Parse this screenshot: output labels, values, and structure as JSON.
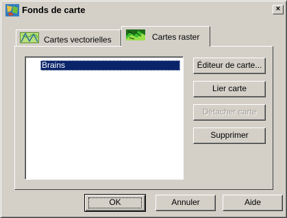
{
  "window": {
    "title": "Fonds de carte",
    "close_label": "×"
  },
  "tabs": [
    {
      "label": "Cartes vectorielles",
      "icon": "vector-map-icon",
      "active": false
    },
    {
      "label": "Cartes raster",
      "icon": "raster-map-icon",
      "active": true
    }
  ],
  "map_list": {
    "items": [
      {
        "label": "Brains",
        "selected": true
      }
    ]
  },
  "side_buttons": {
    "editor": "Éditeur de carte...",
    "link": "Lier carte",
    "detach": "Détacher carte",
    "delete": "Supprimer"
  },
  "footer_buttons": {
    "ok": "OK",
    "cancel": "Annuler",
    "help": "Aide"
  },
  "colors": {
    "face": "#d4d0c8",
    "selection": "#0a246a",
    "disabled_text": "#a09d96"
  }
}
